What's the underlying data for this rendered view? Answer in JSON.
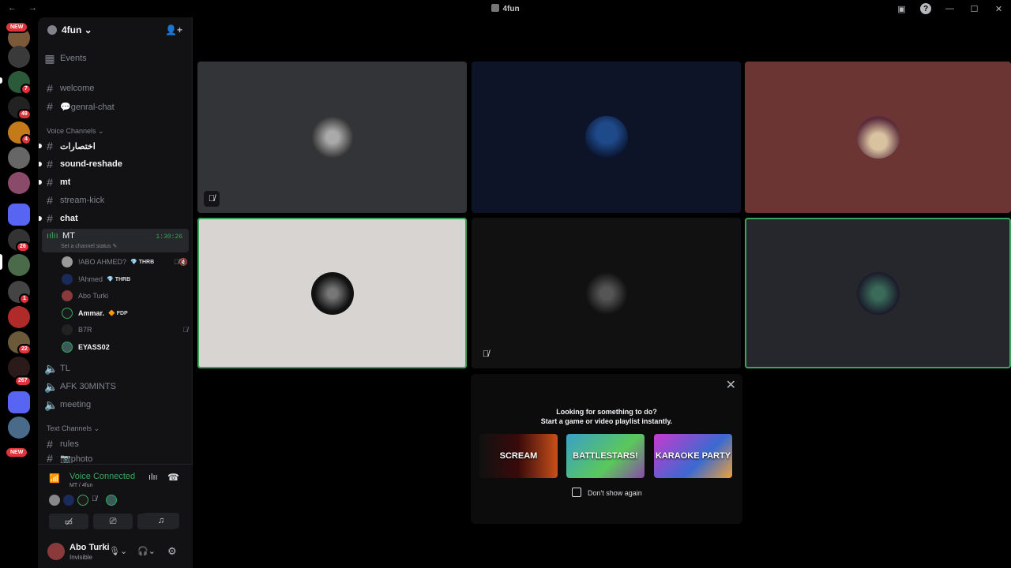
{
  "titlebar": {
    "title": "4fun",
    "nav": "← →"
  },
  "servers": {
    "new_label": "NEW",
    "badges": [
      "7",
      "49",
      "4",
      "26",
      "1",
      "22",
      "267"
    ]
  },
  "guild": {
    "name": "4fun ⌄"
  },
  "channels": {
    "events": "Events",
    "welcome": "welcome",
    "genral_chat": "💬genral-chat",
    "voice_category": "Voice Channels ⌄",
    "ch_arabic": "اختصارات",
    "sound_reshade": "sound-reshade",
    "mt_text": "mt",
    "stream_kick": "stream-kick",
    "chat": "chat",
    "mt_voice": "MT",
    "mt_timer": "1:30:26",
    "mt_status": "Set a channel status ✎",
    "tl": "TL",
    "afk": "AFK 30MINTS",
    "meeting": "meeting",
    "text_category": "Text Channels ⌄",
    "rules": "rules",
    "photo": "📷photo"
  },
  "voice_users": [
    {
      "name": "!ABO AHMED?",
      "tag": "💎 THRB",
      "icons": "🎙̸🔇",
      "bold": false
    },
    {
      "name": "!Ahmed",
      "tag": "💎 THRB",
      "icons": "",
      "bold": false
    },
    {
      "name": "Abo Turki",
      "tag": "",
      "icons": "",
      "bold": false
    },
    {
      "name": "Ammar.",
      "tag": "🔶 FDP",
      "icons": "",
      "bold": true
    },
    {
      "name": "B7R",
      "tag": "",
      "icons": "🎙̸",
      "bold": false
    },
    {
      "name": "EYASS02",
      "tag": "",
      "icons": "",
      "bold": true
    }
  ],
  "voice_panel": {
    "status": "Voice Connected",
    "location": "MT / 4fun"
  },
  "user": {
    "name": "Abo Turki",
    "status": "Invisible"
  },
  "stage": {
    "mic_off_icon": "🎙̸"
  },
  "activity": {
    "line1": "Looking for something to do?",
    "line2": "Start a game or video playlist instantly.",
    "games": [
      "SCREAM",
      "BATTLESTARS!",
      "KARAOKE PARTY"
    ],
    "checkbox_label": "Don't show again",
    "close": "✕"
  }
}
